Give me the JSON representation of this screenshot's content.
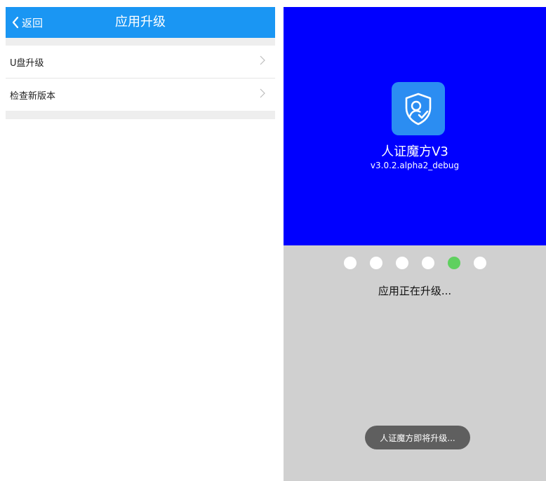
{
  "settings_screen": {
    "header": {
      "back_label": "返回",
      "title": "应用升级"
    },
    "menu": [
      {
        "label": "U盘升级"
      },
      {
        "label": "检查新版本"
      }
    ]
  },
  "upgrade_screen": {
    "app_name": "人证魔方V3",
    "app_version": "v3.0.2.alpha2_debug",
    "progress": {
      "step": 5,
      "total": 6
    },
    "status_text": "应用正在升级...",
    "toast_text": "人证魔方即将升级..."
  },
  "colors": {
    "header_bg": "#1a96f3",
    "splash_bg": "#0000ff",
    "upgrade_bg": "#d0d0d0",
    "active_dot": "#5fd05f"
  },
  "icons": {
    "back": "chevron-left-icon",
    "row_arrow": "chevron-right-icon",
    "app": "shield-user-check-icon"
  }
}
